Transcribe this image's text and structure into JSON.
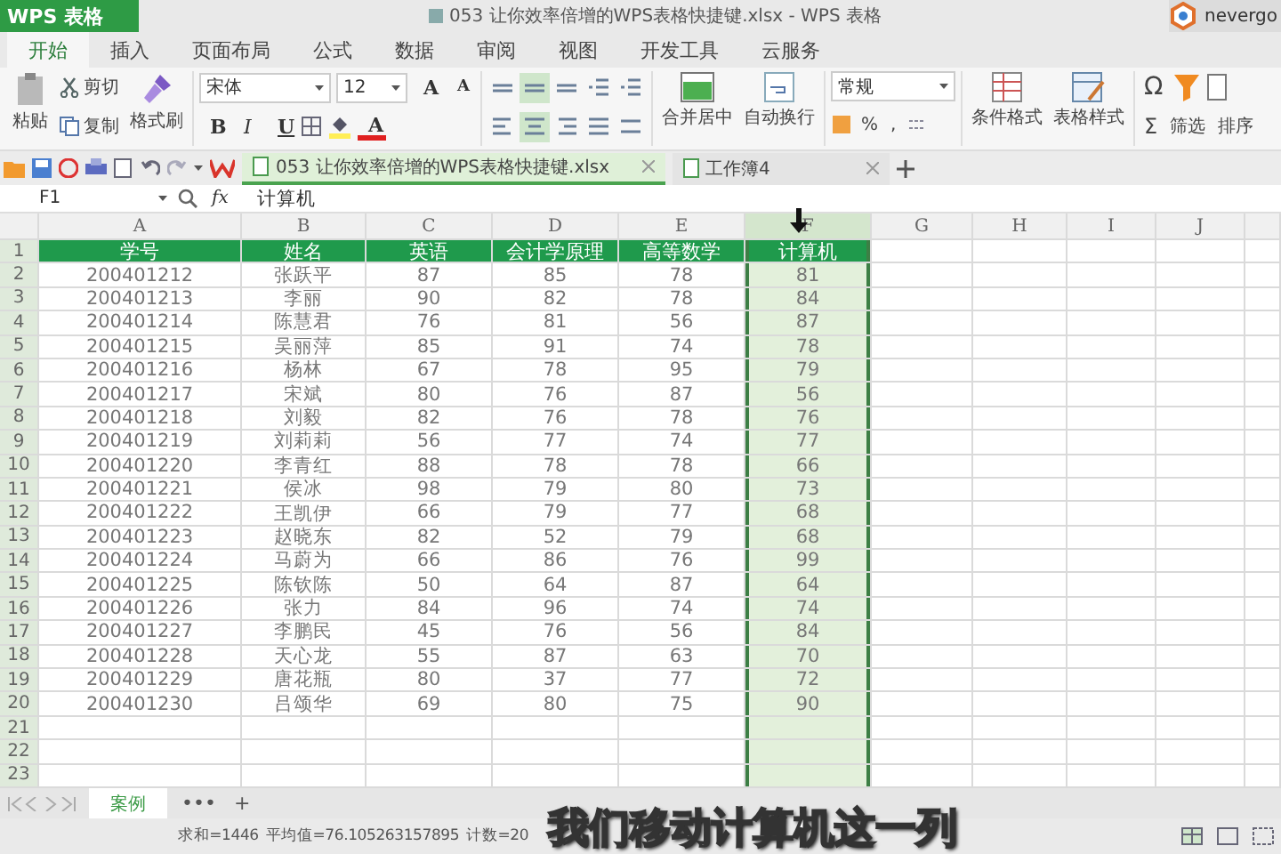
{
  "app_button": "WPS 表格",
  "window": {
    "title": "053 让你效率倍增的WPS表格快捷键.xlsx - WPS 表格",
    "user": "nevergo"
  },
  "menu_tabs": [
    {
      "label": "开始",
      "selected": true
    },
    {
      "label": "插入",
      "selected": false
    },
    {
      "label": "页面布局",
      "selected": false
    },
    {
      "label": "公式",
      "selected": false
    },
    {
      "label": "数据",
      "selected": false
    },
    {
      "label": "审阅",
      "selected": false
    },
    {
      "label": "视图",
      "selected": false
    },
    {
      "label": "开发工具",
      "selected": false
    },
    {
      "label": "云服务",
      "selected": false
    }
  ],
  "ribbon": {
    "paste": "粘贴",
    "cut": "剪切",
    "copy": "复制",
    "format_painter": "格式刷",
    "font_name": "宋体",
    "font_size": "12",
    "grow_font": "A",
    "shrink_font": "A",
    "bold": "B",
    "italic": "I",
    "underline": "U",
    "font_color": "A",
    "align_buttons": [
      {
        "kind": "top",
        "selected": false
      },
      {
        "kind": "middle",
        "selected": true
      },
      {
        "kind": "bottom",
        "selected": false
      },
      {
        "kind": "outdent",
        "selected": false
      },
      {
        "kind": "indent",
        "selected": false
      },
      {
        "kind": "left",
        "selected": false
      },
      {
        "kind": "center",
        "selected": true
      },
      {
        "kind": "right",
        "selected": false
      },
      {
        "kind": "justify",
        "selected": false
      },
      {
        "kind": "distribute",
        "selected": false
      }
    ],
    "merge": "合并居中",
    "wrap": "自动换行",
    "number_format": "常规",
    "percent": "%",
    "comma": ",",
    "conditional_format": "条件格式",
    "table_style": "表格样式",
    "symbol": "Ω",
    "sum": "Σ",
    "filter": "筛选",
    "sort": "排序"
  },
  "doc_tabs": [
    {
      "label": "053 让你效率倍增的WPS表格快捷键.xlsx",
      "selected": true
    },
    {
      "label": "工作簿4",
      "selected": false
    }
  ],
  "formula_bar": {
    "cell": "F1",
    "function": "fx",
    "content": "计算机"
  },
  "sheet": {
    "columns": [
      {
        "label": "A",
        "selected": false
      },
      {
        "label": "B",
        "selected": false
      },
      {
        "label": "C",
        "selected": false
      },
      {
        "label": "D",
        "selected": false
      },
      {
        "label": "E",
        "selected": false
      },
      {
        "label": "F",
        "selected": true
      },
      {
        "label": "G",
        "selected": false
      },
      {
        "label": "H",
        "selected": false
      },
      {
        "label": "I",
        "selected": false
      },
      {
        "label": "J",
        "selected": false
      }
    ],
    "row_numbers": [
      "1",
      "2",
      "3",
      "4",
      "5",
      "6",
      "7",
      "8",
      "9",
      "10",
      "11",
      "12",
      "13",
      "14",
      "15",
      "16",
      "17",
      "18",
      "19",
      "20",
      "21",
      "22",
      "23"
    ],
    "rows": [
      {
        "kind": "header",
        "cells": [
          "学号",
          "姓名",
          "英语",
          "会计学原理",
          "高等数学",
          "计算机"
        ]
      },
      {
        "kind": "data",
        "cells": [
          "200401212",
          "张跃平",
          "87",
          "85",
          "78",
          "81"
        ]
      },
      {
        "kind": "data",
        "cells": [
          "200401213",
          "李丽",
          "90",
          "82",
          "78",
          "84"
        ]
      },
      {
        "kind": "data",
        "cells": [
          "200401214",
          "陈慧君",
          "76",
          "81",
          "56",
          "87"
        ]
      },
      {
        "kind": "data",
        "cells": [
          "200401215",
          "吴丽萍",
          "85",
          "91",
          "74",
          "78"
        ]
      },
      {
        "kind": "data",
        "cells": [
          "200401216",
          "杨林",
          "67",
          "78",
          "95",
          "79"
        ]
      },
      {
        "kind": "data",
        "cells": [
          "200401217",
          "宋斌",
          "80",
          "76",
          "87",
          "56"
        ]
      },
      {
        "kind": "data",
        "cells": [
          "200401218",
          "刘毅",
          "82",
          "76",
          "78",
          "76"
        ]
      },
      {
        "kind": "data",
        "cells": [
          "200401219",
          "刘莉莉",
          "56",
          "77",
          "74",
          "77"
        ]
      },
      {
        "kind": "data",
        "cells": [
          "200401220",
          "李青红",
          "88",
          "78",
          "78",
          "66"
        ]
      },
      {
        "kind": "data",
        "cells": [
          "200401221",
          "侯冰",
          "98",
          "79",
          "80",
          "73"
        ]
      },
      {
        "kind": "data",
        "cells": [
          "200401222",
          "王凯伊",
          "66",
          "79",
          "77",
          "68"
        ]
      },
      {
        "kind": "data",
        "cells": [
          "200401223",
          "赵晓东",
          "82",
          "52",
          "79",
          "68"
        ]
      },
      {
        "kind": "data",
        "cells": [
          "200401224",
          "马蔚为",
          "66",
          "86",
          "76",
          "99"
        ]
      },
      {
        "kind": "data",
        "cells": [
          "200401225",
          "陈钦陈",
          "50",
          "64",
          "87",
          "64"
        ]
      },
      {
        "kind": "data",
        "cells": [
          "200401226",
          "张力",
          "84",
          "96",
          "74",
          "74"
        ]
      },
      {
        "kind": "data",
        "cells": [
          "200401227",
          "李鹏民",
          "45",
          "76",
          "56",
          "84"
        ]
      },
      {
        "kind": "data",
        "cells": [
          "200401228",
          "天心龙",
          "55",
          "87",
          "63",
          "70"
        ]
      },
      {
        "kind": "data",
        "cells": [
          "200401229",
          "唐花瓶",
          "80",
          "37",
          "77",
          "72"
        ]
      },
      {
        "kind": "data",
        "cells": [
          "200401230",
          "吕颂华",
          "69",
          "80",
          "75",
          "90"
        ]
      }
    ]
  },
  "sheet_tabs": [
    {
      "label": "案例",
      "selected": true
    }
  ],
  "sheet_tab_more": "•••",
  "sheet_tab_add": "+",
  "status_bar": [
    "求和=1446",
    "平均值=76.105263157895",
    "计数=20"
  ],
  "subtitle": "我们移动计算机这一列"
}
